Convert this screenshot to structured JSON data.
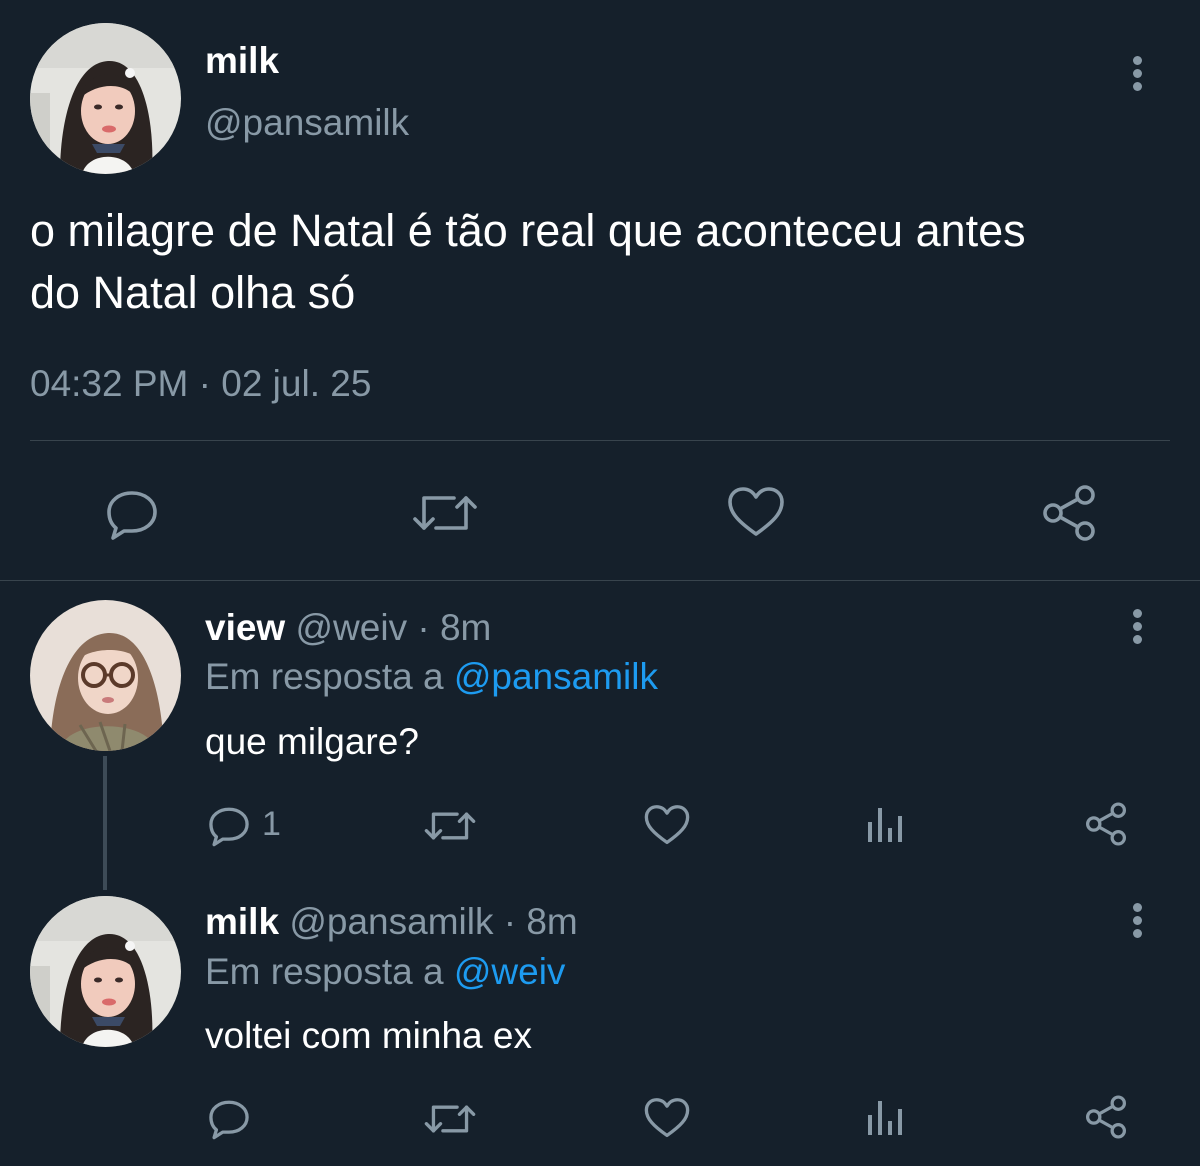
{
  "colors": {
    "background": "#15202b",
    "text": "#ffffff",
    "muted": "#8899a6",
    "link": "#1d9bf0",
    "divider": "#38444d"
  },
  "main_tweet": {
    "display_name": "milk",
    "handle": "@pansamilk",
    "text_line1": "o milagre de Natal é tão real que aconteceu antes",
    "text_line2": "do Natal olha só",
    "timestamp": "04:32 PM · 02 jul. 25",
    "actions": [
      "reply-icon",
      "retweet-icon",
      "like-icon",
      "share-icon"
    ]
  },
  "replies": [
    {
      "display_name": "view",
      "meta": "@weiv · 8m",
      "reply_prefix": "Em resposta a",
      "reply_to": "@pansamilk",
      "text": "que milgare?",
      "reply_count": "1"
    },
    {
      "display_name": "milk",
      "meta": "@pansamilk · 8m",
      "reply_prefix": "Em resposta a",
      "reply_to": "@weiv",
      "text": "voltei com minha ex",
      "reply_count": ""
    }
  ]
}
